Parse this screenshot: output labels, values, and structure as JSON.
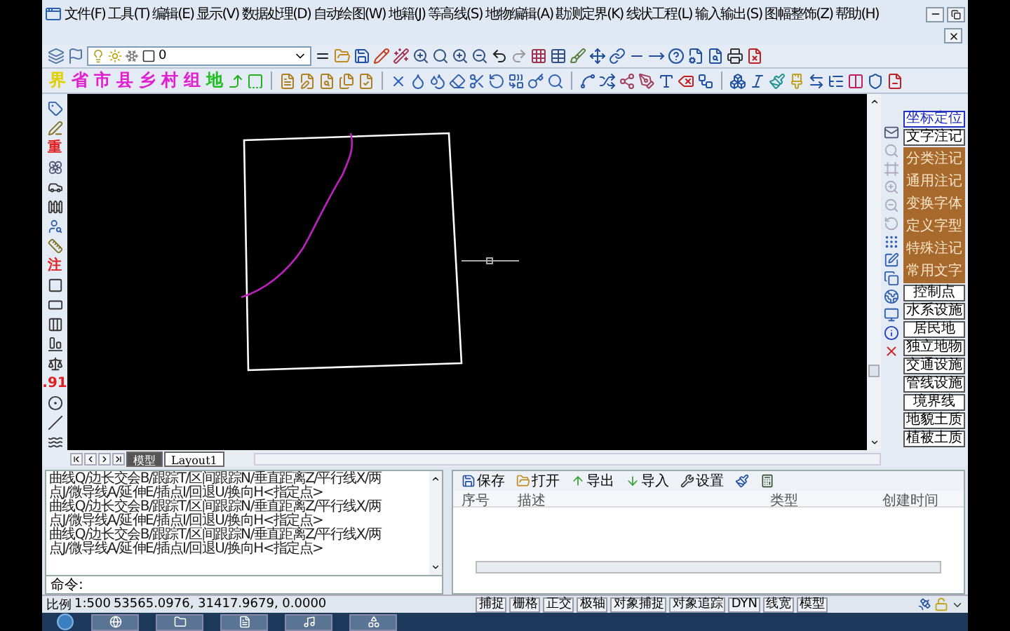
{
  "menu_bar": {
    "items": [
      "文件(F)",
      "工具(T)",
      "编辑(E)",
      "显示(V)",
      "数据处理(D)",
      "自动绘图(W)",
      "地籍(J)",
      "等高线(S)",
      "地物编辑(A)",
      "勘测定界(K)",
      "线状工程(L)",
      "输入输出(S)",
      "图幅整饰(Z)",
      "帮助(H)"
    ]
  },
  "layer_selector": {
    "value": "0"
  },
  "map_toolbar": {
    "items": [
      {
        "label": "界",
        "color": "#e0d000"
      },
      {
        "label": "省",
        "color": "#e020d0"
      },
      {
        "label": "市",
        "color": "#e020d0"
      },
      {
        "label": "县",
        "color": "#e020d0"
      },
      {
        "label": "乡",
        "color": "#e020d0"
      },
      {
        "label": "村",
        "color": "#e020d0"
      },
      {
        "label": "组",
        "color": "#e020d0"
      },
      {
        "label": "地",
        "color": "#20c020"
      }
    ]
  },
  "left_toolbar": {
    "items": [
      {
        "kind": "icon"
      },
      {
        "kind": "icon"
      },
      {
        "kind": "glyph",
        "label": "重"
      },
      {
        "kind": "icon"
      },
      {
        "kind": "icon"
      },
      {
        "kind": "icon"
      },
      {
        "kind": "icon"
      },
      {
        "kind": "icon"
      },
      {
        "kind": "glyph",
        "label": "注"
      },
      {
        "kind": "icon"
      },
      {
        "kind": "icon"
      },
      {
        "kind": "icon"
      },
      {
        "kind": "icon"
      },
      {
        "kind": "icon"
      },
      {
        "kind": "glyph",
        "label": ".91"
      },
      {
        "kind": "icon"
      },
      {
        "kind": "icon"
      },
      {
        "kind": "icon"
      }
    ]
  },
  "layout_tabs": [
    {
      "label": "模型",
      "selected": true
    },
    {
      "label": "Layout1",
      "selected": false
    }
  ],
  "right_panel": {
    "items": [
      {
        "kind": "button",
        "label": "坐标定位",
        "selected": true
      },
      {
        "kind": "button",
        "label": "文字注记",
        "selected": false
      },
      {
        "kind": "sub",
        "label": "分类注记"
      },
      {
        "kind": "sub",
        "label": "通用注记"
      },
      {
        "kind": "sub",
        "label": "变换字体"
      },
      {
        "kind": "sub",
        "label": "定义字型"
      },
      {
        "kind": "sub",
        "label": "特殊注记"
      },
      {
        "kind": "sub",
        "label": "常用文字"
      },
      {
        "kind": "button",
        "label": "控制点",
        "selected": false
      },
      {
        "kind": "button",
        "label": "水系设施",
        "selected": false
      },
      {
        "kind": "button",
        "label": "居民地",
        "selected": false
      },
      {
        "kind": "button",
        "label": "独立地物",
        "selected": false
      },
      {
        "kind": "button",
        "label": "交通设施",
        "selected": false
      },
      {
        "kind": "button",
        "label": "管线设施",
        "selected": false
      },
      {
        "kind": "button",
        "label": "境界线",
        "selected": false
      },
      {
        "kind": "button",
        "label": "地貌土质",
        "selected": false
      },
      {
        "kind": "button",
        "label": "植被土质",
        "selected": false
      }
    ]
  },
  "command": {
    "history": [
      "曲线Q/边长交会B/跟踪T/区间跟踪N/垂直距离Z/平行线X/两",
      "点J/微导线A/延伸E/插点I/回退U/换向H<指定点>",
      "曲线Q/边长交会B/跟踪T/区间跟踪N/垂直距离Z/平行线X/两",
      "点J/微导线A/延伸E/插点I/回退U/换向H<指定点>",
      "曲线Q/边长交会B/跟踪T/区间跟踪N/垂直距离Z/平行线X/两",
      "点J/微导线A/延伸E/插点I/回退U/换向H<指定点>"
    ],
    "prompt": "命令:"
  },
  "object_panel": {
    "toolbar": [
      "保存",
      "打开",
      "导出",
      "导入",
      "设置"
    ],
    "columns": [
      "序号",
      "描述",
      "类型",
      "创建时间"
    ]
  },
  "status_bar": {
    "scale_label": "比例",
    "scale": "1:500",
    "coordinates": "53565.0976, 31417.9679, 0.0000",
    "toggles": [
      "捕捉",
      "栅格",
      "正交",
      "极轴",
      "对象捕捉",
      "对象追踪",
      "DYN",
      "线宽",
      "模型"
    ]
  }
}
